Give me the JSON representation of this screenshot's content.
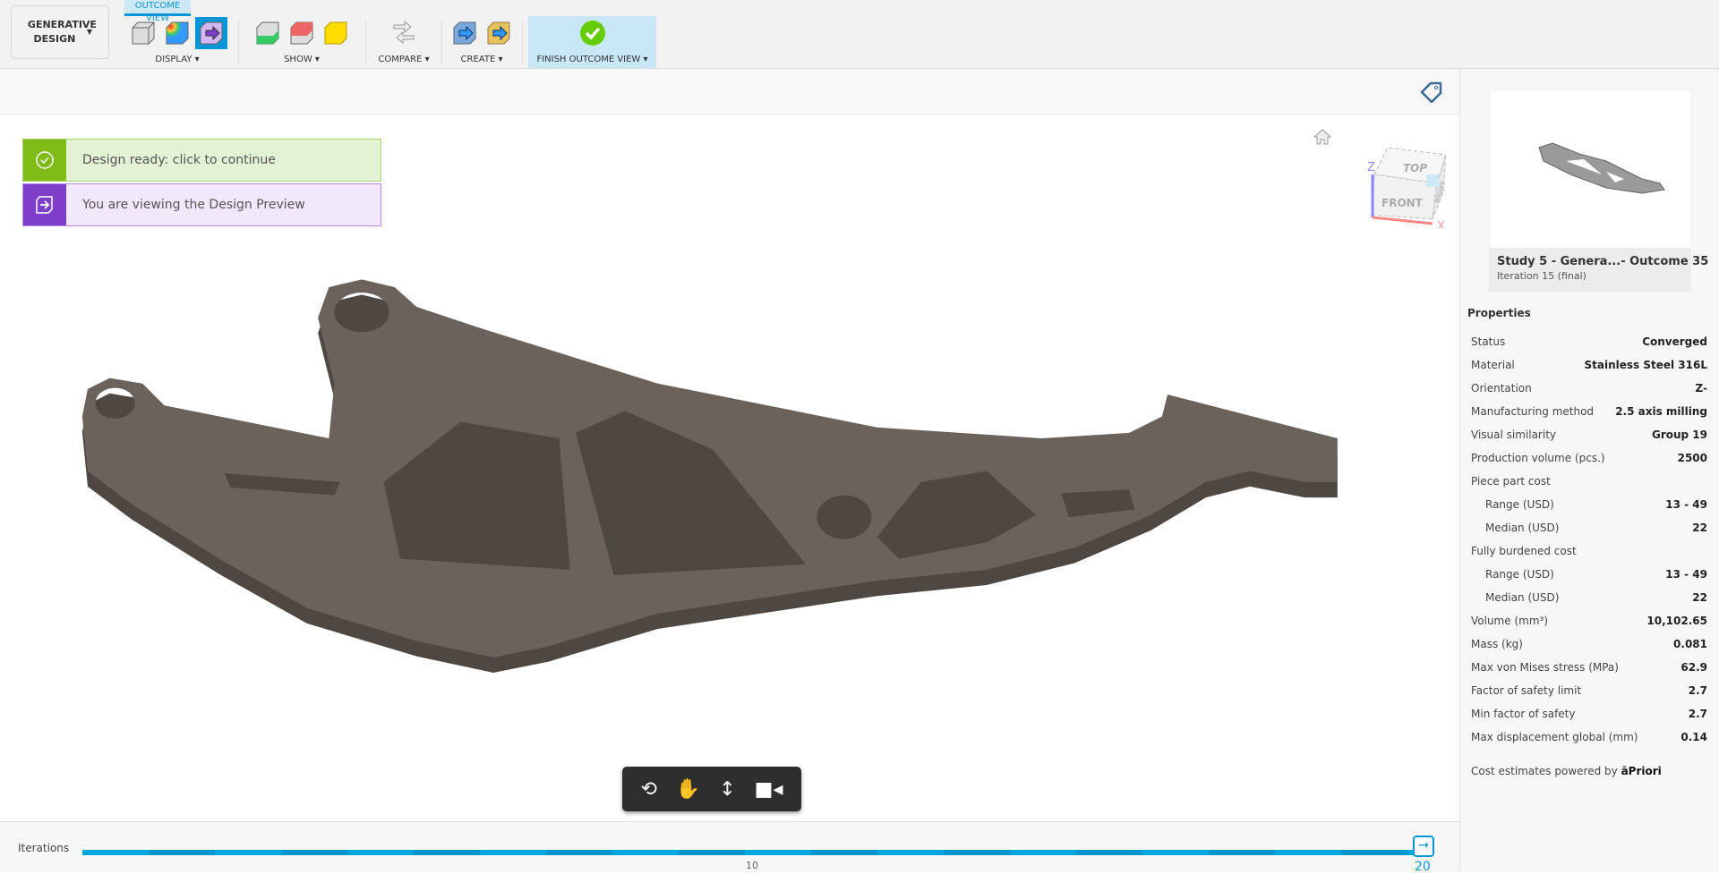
{
  "toolbar": {
    "workspace": "GENERATIVE DESIGN",
    "active_tab": "OUTCOME VIEW",
    "groups": {
      "display": "DISPLAY",
      "show": "SHOW",
      "compare": "COMPARE",
      "create": "CREATE",
      "finish": "FINISH OUTCOME VIEW"
    }
  },
  "notifications": [
    {
      "text": "Design ready: click to continue",
      "icon": "check-circle-icon",
      "color": "#7fbb17"
    },
    {
      "text": "You are viewing the Design Preview",
      "icon": "preview-arrow-icon",
      "color": "#7e3ec9"
    }
  ],
  "viewcube": {
    "top": "TOP",
    "front": "FRONT",
    "right": "RIGHT",
    "z": "Z",
    "x": "X"
  },
  "outcome": {
    "title": "Study 5 - Genera...- Outcome 35",
    "subtitle": "Iteration 15 (final)"
  },
  "properties": {
    "heading": "Properties",
    "rows": [
      {
        "k": "Status",
        "v": "Converged"
      },
      {
        "k": "Material",
        "v": "Stainless Steel 316L"
      },
      {
        "k": "Orientation",
        "v": "Z-"
      },
      {
        "k": "Manufacturing method",
        "v": "2.5 axis milling"
      },
      {
        "k": "Visual similarity",
        "v": "Group 19"
      },
      {
        "k": "Production volume (pcs.)",
        "v": "2500"
      },
      {
        "k": "Piece part cost",
        "v": ""
      },
      {
        "k": "Range (USD)",
        "v": "13 - 49"
      },
      {
        "k": "Median (USD)",
        "v": "22"
      },
      {
        "k": "Fully burdened cost",
        "v": ""
      },
      {
        "k": "Range (USD)",
        "v": "13 - 49"
      },
      {
        "k": "Median (USD)",
        "v": "22"
      },
      {
        "k": "Volume (mm³)",
        "v": "10,102.65"
      },
      {
        "k": "Mass (kg)",
        "v": "0.081"
      },
      {
        "k": "Max von Mises stress (MPa)",
        "v": "62.9"
      },
      {
        "k": "Factor of safety limit",
        "v": "2.7"
      },
      {
        "k": "Min factor of safety",
        "v": "2.7"
      },
      {
        "k": "Max displacement global (mm)",
        "v": "0.14"
      }
    ],
    "powered_by": "Cost estimates powered by",
    "brand": "aPriori"
  },
  "iterations": {
    "label": "Iterations",
    "tick_mid": "10",
    "current": "20",
    "progress": 1.0
  },
  "colors": {
    "accent": "#0696d7",
    "part": "#6b625c"
  }
}
